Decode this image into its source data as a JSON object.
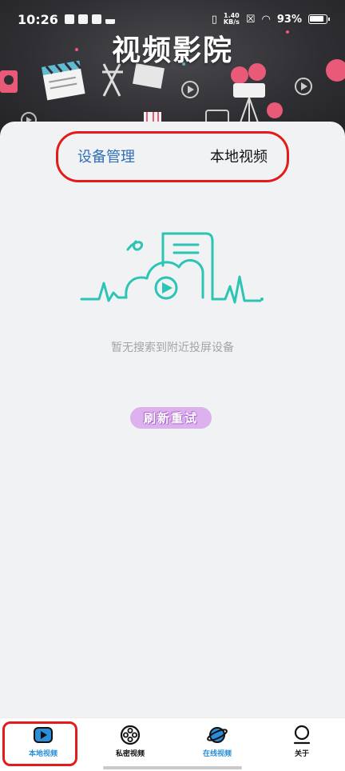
{
  "status_bar": {
    "time": "10:26",
    "net_speed_value": "1.40",
    "net_speed_unit": "KB/s",
    "battery": "93%"
  },
  "header": {
    "title": "视频影院"
  },
  "tabs": {
    "device": "设备管理",
    "local": "本地视频"
  },
  "empty_state": {
    "message": "暂无搜索到附近投屏设备",
    "retry_label": "刷新重试"
  },
  "bottom_nav": {
    "items": [
      {
        "label": "本地视频",
        "icon": "play-square-icon",
        "active": true
      },
      {
        "label": "私密视频",
        "icon": "film-reel-icon",
        "active": false
      },
      {
        "label": "在线视频",
        "icon": "planet-icon",
        "active": false
      },
      {
        "label": "关于",
        "icon": "person-outline-icon",
        "active": false
      }
    ]
  },
  "colors": {
    "accent_blue": "#2f6fb8",
    "teal_illustration": "#2cc4b4",
    "retry_bg": "#dcb1ee",
    "highlight_red": "#e21b1b",
    "banner_dark": "#2f2f33"
  }
}
